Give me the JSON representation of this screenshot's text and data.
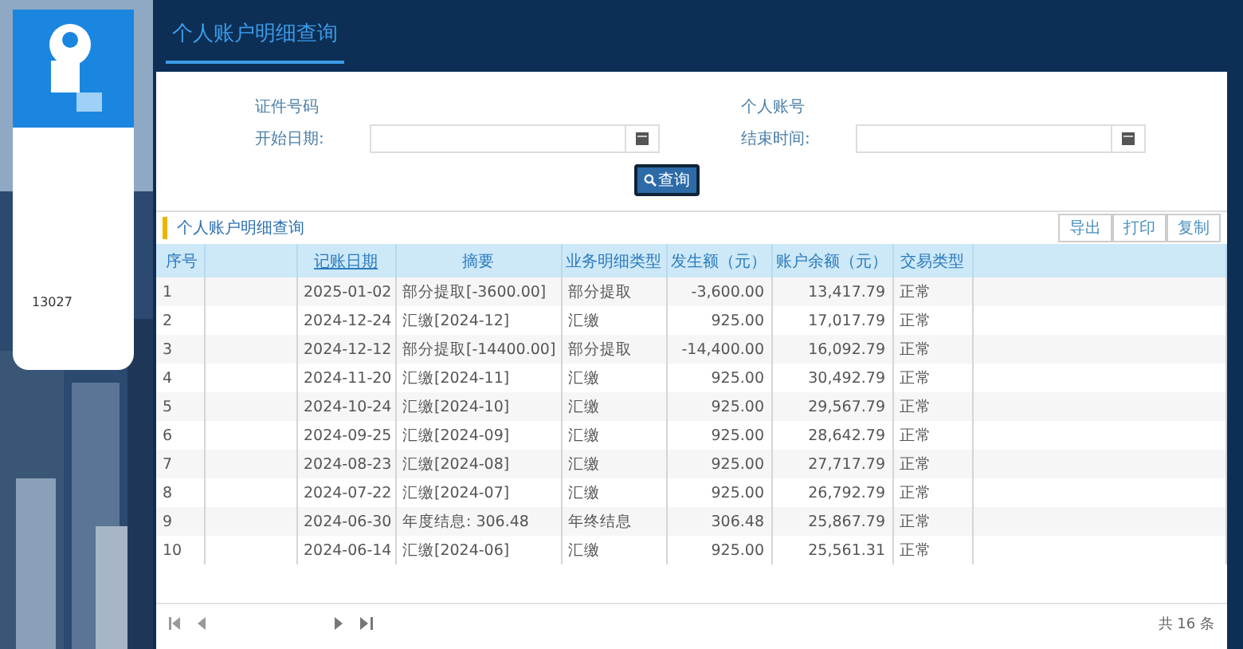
{
  "sidebar": {
    "id_text": "13027"
  },
  "header": {
    "tab": "个人账户明细查询"
  },
  "form": {
    "fields": [
      {
        "label": "证件号码",
        "kind": "text"
      },
      {
        "label": "个人账号",
        "kind": "text"
      },
      {
        "label": "开始日期:",
        "kind": "date"
      },
      {
        "label": "结束时间:",
        "kind": "date"
      }
    ],
    "search_button": "查询"
  },
  "panel": {
    "title": "个人账户明细查询",
    "actions": [
      "导出",
      "打印",
      "复制"
    ]
  },
  "table": {
    "columns": [
      "序号",
      "",
      "记账日期",
      "摘要",
      "业务明细类型",
      "发生额（元）",
      "账户余额（元）",
      "交易类型"
    ],
    "rows": [
      [
        "1",
        "",
        "2025-01-02",
        "部分提取[-3600.00]",
        "部分提取",
        "-3,600.00",
        "13,417.79",
        "正常"
      ],
      [
        "2",
        "",
        "2024-12-24",
        "汇缴[2024-12]",
        "汇缴",
        "925.00",
        "17,017.79",
        "正常"
      ],
      [
        "3",
        "",
        "2024-12-12",
        "部分提取[-14400.00]",
        "部分提取",
        "-14,400.00",
        "16,092.79",
        "正常"
      ],
      [
        "4",
        "",
        "2024-11-20",
        "汇缴[2024-11]",
        "汇缴",
        "925.00",
        "30,492.79",
        "正常"
      ],
      [
        "5",
        "",
        "2024-10-24",
        "汇缴[2024-10]",
        "汇缴",
        "925.00",
        "29,567.79",
        "正常"
      ],
      [
        "6",
        "",
        "2024-09-25",
        "汇缴[2024-09]",
        "汇缴",
        "925.00",
        "28,642.79",
        "正常"
      ],
      [
        "7",
        "",
        "2024-08-23",
        "汇缴[2024-08]",
        "汇缴",
        "925.00",
        "27,717.79",
        "正常"
      ],
      [
        "8",
        "",
        "2024-07-22",
        "汇缴[2024-07]",
        "汇缴",
        "925.00",
        "26,792.79",
        "正常"
      ],
      [
        "9",
        "",
        "2024-06-30",
        "年度结息: 306.48",
        "年终结息",
        "306.48",
        "25,867.79",
        "正常"
      ],
      [
        "10",
        "",
        "2024-06-14",
        "汇缴[2024-06]",
        "汇缴",
        "925.00",
        "25,561.31",
        "正常"
      ]
    ]
  },
  "pager": {
    "total": "共 16 条"
  }
}
